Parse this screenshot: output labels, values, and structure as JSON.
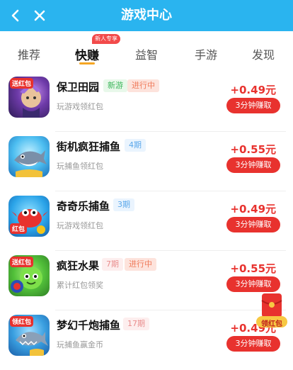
{
  "header": {
    "title": "游戏中心"
  },
  "tabs": [
    {
      "label": "推荐"
    },
    {
      "label": "快赚"
    },
    {
      "label": "益智"
    },
    {
      "label": "手游"
    },
    {
      "label": "发现"
    }
  ],
  "tab_badge": "新人专享",
  "games": [
    {
      "name": "保卫田园",
      "tags": [
        "新游",
        "进行中"
      ],
      "desc": "玩游戏领红包",
      "reward": "+0.49元",
      "button": "3分钟赚取",
      "icon_label": "送红包"
    },
    {
      "name": "街机疯狂捕鱼",
      "tags": [
        "4期"
      ],
      "desc": "玩捕鱼领红包",
      "reward": "+0.55元",
      "button": "3分钟赚取",
      "icon_label": ""
    },
    {
      "name": "奇奇乐捕鱼",
      "tags": [
        "3期"
      ],
      "desc": "玩游戏领红包",
      "reward": "+0.49元",
      "button": "3分钟赚取",
      "icon_label": "红包"
    },
    {
      "name": "疯狂水果",
      "tags": [
        "7期",
        "进行中"
      ],
      "desc": "累计红包领奖",
      "reward": "+0.55元",
      "button": "3分钟赚取",
      "icon_label": "送红包"
    },
    {
      "name": "梦幻千炮捕鱼",
      "tags": [
        "17期"
      ],
      "desc": "玩捕鱼赢金币",
      "reward": "+0.49元",
      "button": "3分钟赚取",
      "icon_label": "领红包"
    }
  ],
  "floating": {
    "label": "领红包"
  }
}
